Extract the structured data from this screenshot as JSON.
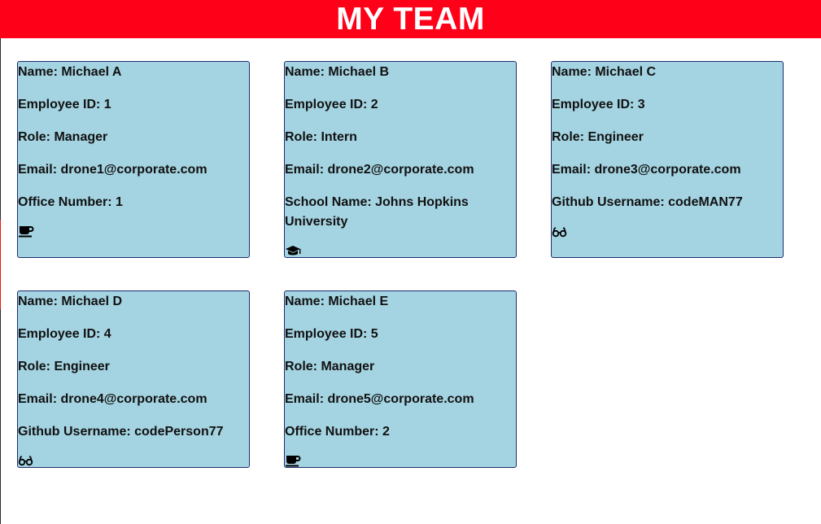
{
  "header": {
    "title": "MY TEAM",
    "background": "#ff0019"
  },
  "card_color": "#a4d3e1",
  "employees": [
    {
      "name": "Name: Michael A",
      "id": "Employee ID: 1",
      "role": "Role: Manager",
      "email": "Email: drone1@corporate.com",
      "extra": "Office Number: 1",
      "icon": "coffee-icon"
    },
    {
      "name": "Name: Michael B",
      "id": "Employee ID: 2",
      "role": "Role: Intern",
      "email": "Email: drone2@corporate.com",
      "extra": "School Name: Johns Hopkins University",
      "icon": "graduation-cap-icon"
    },
    {
      "name": "Name: Michael C",
      "id": "Employee ID: 3",
      "role": "Role: Engineer",
      "email": "Email: drone3@corporate.com",
      "extra": "Github Username: codeMAN77",
      "icon": "glasses-icon"
    },
    {
      "name": "Name: Michael D",
      "id": "Employee ID: 4",
      "role": "Role: Engineer",
      "email": "Email: drone4@corporate.com",
      "extra": "Github Username: codePerson77",
      "icon": "glasses-icon"
    },
    {
      "name": "Name: Michael E",
      "id": "Employee ID: 5",
      "role": "Role: Manager",
      "email": "Email: drone5@corporate.com",
      "extra": "Office Number: 2",
      "icon": "coffee-icon"
    }
  ]
}
